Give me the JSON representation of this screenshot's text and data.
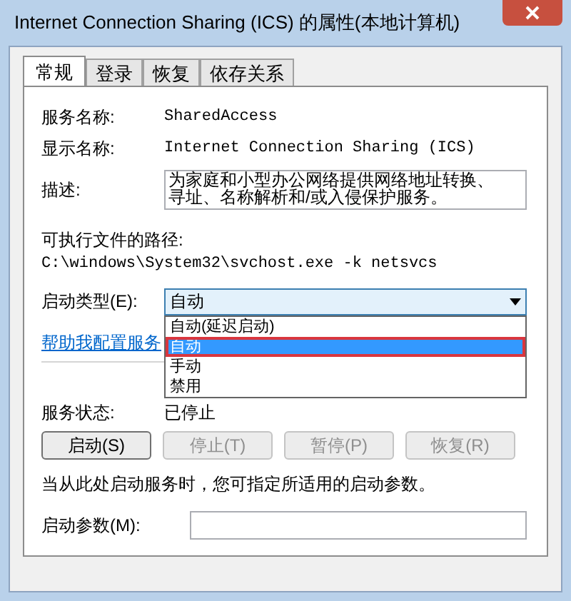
{
  "window": {
    "title": "Internet Connection Sharing (ICS) 的属性(本地计算机)"
  },
  "tabs": [
    {
      "label": "常规",
      "selected": true
    },
    {
      "label": "登录",
      "selected": false
    },
    {
      "label": "恢复",
      "selected": false
    },
    {
      "label": "依存关系",
      "selected": false
    }
  ],
  "fields": [
    {
      "label": "服务名称:",
      "value": "SharedAccess"
    },
    {
      "label": "显示名称:",
      "value": "Internet Connection Sharing (ICS)"
    }
  ],
  "description": {
    "label": "描述:",
    "value": "为家庭和小型办公网络提供网络地址转换、寻址、名称解析和/或入侵保护服务。"
  },
  "path": {
    "label": "可执行文件的路径:",
    "value": "C:\\windows\\System32\\svchost.exe -k netsvcs"
  },
  "startup_type": {
    "label": "启动类型(E):",
    "value": "自动",
    "expanded": true,
    "options": [
      {
        "label": "自动(延迟启动)",
        "selected": false,
        "annotated": false
      },
      {
        "label": "自动",
        "selected": true,
        "annotated": true
      },
      {
        "label": "手动",
        "selected": false,
        "annotated": false
      },
      {
        "label": "禁用",
        "selected": false,
        "annotated": false
      }
    ]
  },
  "help_link": "帮助我配置服务",
  "status": {
    "label": "服务状态:",
    "value": "已停止"
  },
  "buttons": [
    {
      "label": "启动(S)",
      "disabled": false
    },
    {
      "label": "停止(T)",
      "disabled": true
    },
    {
      "label": "暂停(P)",
      "disabled": true
    },
    {
      "label": "恢复(R)",
      "disabled": true
    }
  ],
  "hint": "当从此处启动服务时，您可指定所适用的启动参数。",
  "parameters": {
    "label": "启动参数(M):"
  }
}
